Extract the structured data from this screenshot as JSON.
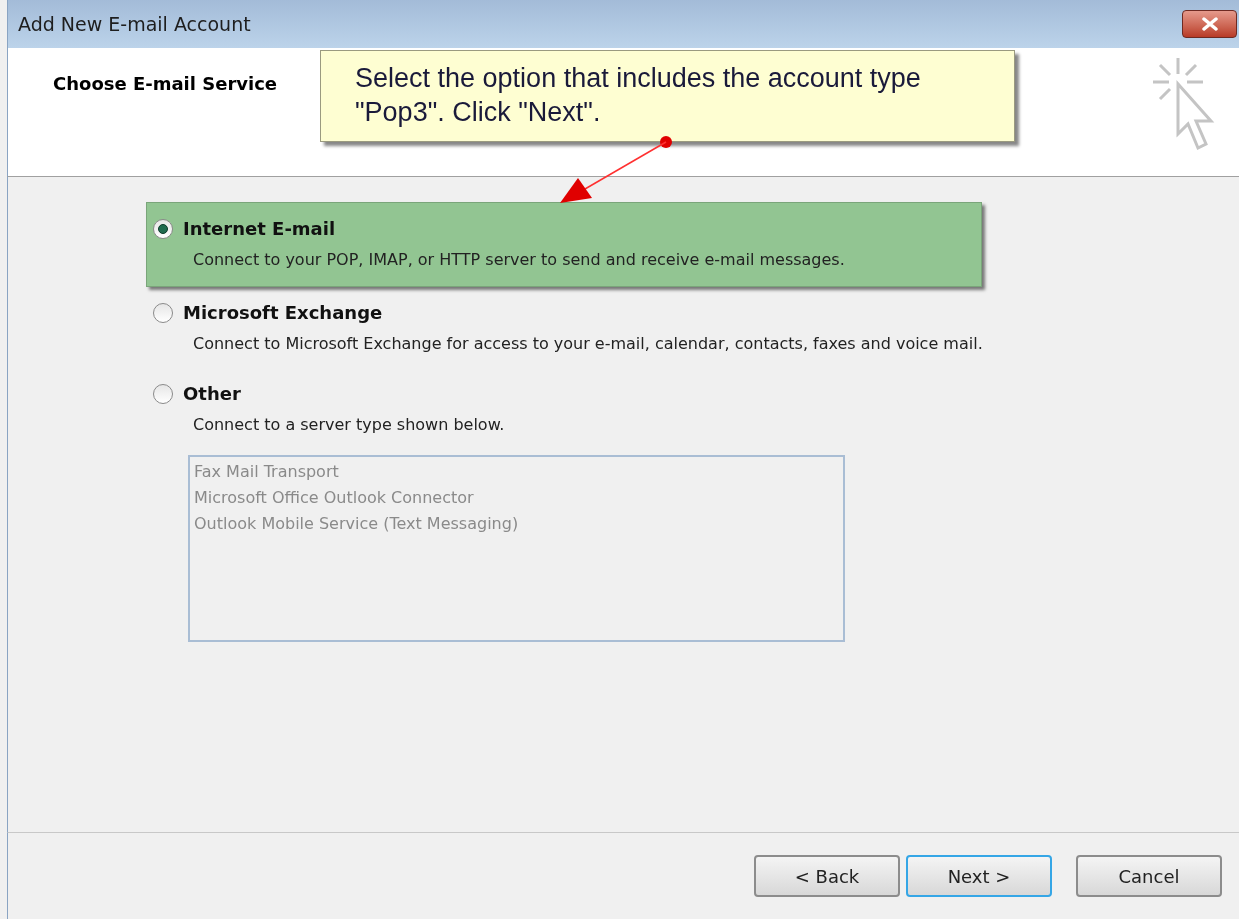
{
  "window": {
    "title": "Add New E-mail Account"
  },
  "header": {
    "title": "Choose E-mail Service"
  },
  "callout": {
    "text": "Select the option that includes the account type \"Pop3\". Click \"Next\"."
  },
  "options": [
    {
      "label": "Internet E-mail",
      "description": "Connect to your POP, IMAP, or HTTP server to send and receive e-mail messages.",
      "selected": true
    },
    {
      "label": "Microsoft Exchange",
      "description": "Connect to Microsoft Exchange for access to your e-mail, calendar, contacts, faxes and voice mail.",
      "selected": false
    },
    {
      "label": "Other",
      "description": "Connect to a server type shown below.",
      "selected": false
    }
  ],
  "server_types": {
    "disabled": true,
    "items": [
      "Fax Mail Transport",
      "Microsoft Office Outlook Connector",
      "Outlook Mobile Service (Text Messaging)"
    ]
  },
  "buttons": [
    {
      "label": "< Back",
      "focused": false
    },
    {
      "label": "Next >",
      "focused": true
    },
    {
      "label": "Cancel",
      "focused": false
    }
  ]
}
